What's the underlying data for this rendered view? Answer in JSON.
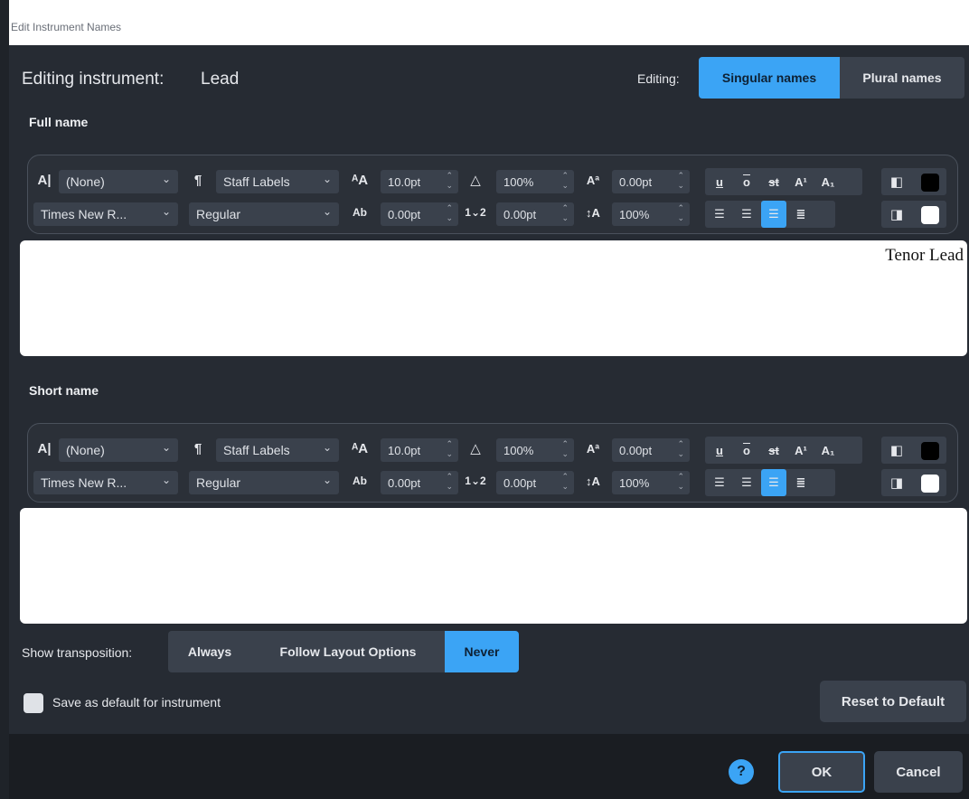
{
  "window": {
    "title": "Edit Instrument Names"
  },
  "header": {
    "editing_instrument_label": "Editing instrument:",
    "instrument_name": "Lead",
    "editing_label": "Editing:",
    "tabs": [
      {
        "label": "Singular names",
        "selected": true
      },
      {
        "label": "Plural names",
        "selected": false
      }
    ]
  },
  "full_name": {
    "section_label": "Full name",
    "char_style": "(None)",
    "para_style": "Staff Labels",
    "font": "Times New R...",
    "font_style": "Regular",
    "size": "10.0pt",
    "scale": "100%",
    "baseline": "0.00pt",
    "tracking": "0.00pt",
    "spacing": "0.00pt",
    "line_spacing": "100%",
    "text": "Tenor Lead",
    "alignment_selected": "right",
    "fg_color": "#000000",
    "bg_color": "#ffffff"
  },
  "short_name": {
    "section_label": "Short name",
    "char_style": "(None)",
    "para_style": "Staff Labels",
    "font": "Times New R...",
    "font_style": "Regular",
    "size": "10.0pt",
    "scale": "100%",
    "baseline": "0.00pt",
    "tracking": "0.00pt",
    "spacing": "0.00pt",
    "line_spacing": "100%",
    "text": "",
    "alignment_selected": "right",
    "fg_color": "#000000",
    "bg_color": "#ffffff"
  },
  "format_buttons": [
    "u",
    "o",
    "st",
    "A¹",
    "A₁"
  ],
  "transposition": {
    "label": "Show transposition:",
    "options": [
      {
        "label": "Always",
        "selected": false
      },
      {
        "label": "Follow Layout Options",
        "selected": false
      },
      {
        "label": "Never",
        "selected": true
      }
    ]
  },
  "save_default": {
    "label": "Save as default for instrument",
    "checked": false
  },
  "buttons": {
    "reset": "Reset to Default",
    "help": "?",
    "ok": "OK",
    "cancel": "Cancel"
  },
  "colors": {
    "accent": "#3ba4f5",
    "dialog_bg": "#262b33",
    "control_bg": "#3a414c"
  }
}
